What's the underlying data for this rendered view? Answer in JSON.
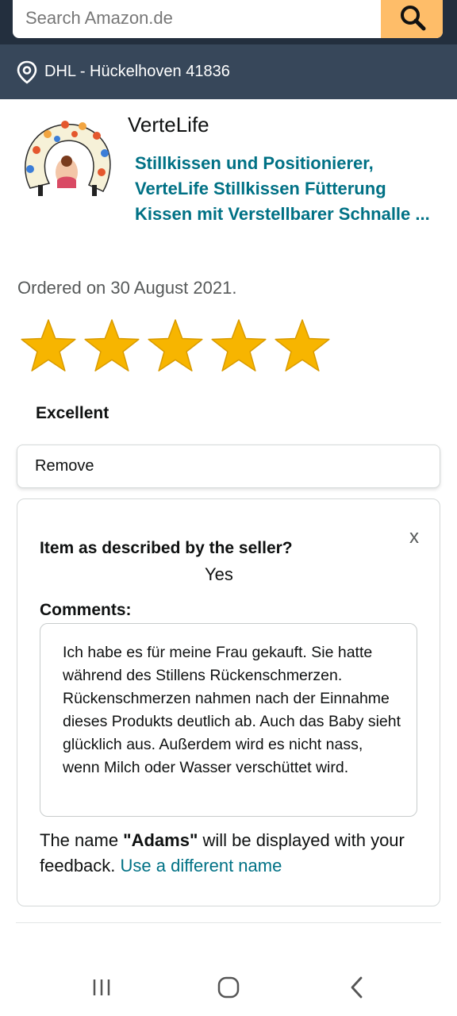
{
  "search": {
    "placeholder": "Search Amazon.de",
    "icon": "search-icon"
  },
  "location": {
    "icon": "location-pin-icon",
    "text": "DHL - Hückelhoven 41836"
  },
  "product": {
    "brand": "VerteLife",
    "title": "Stillkissen und Positionierer, VerteLife Stillkissen Fütterung Kissen mit Verstellbarer Schnalle ...",
    "ordered": "Ordered on 30 August 2021."
  },
  "rating": {
    "stars": 5,
    "max": 5,
    "label": "Excellent",
    "star_color": "#f7b500"
  },
  "remove_label": "Remove",
  "feedback": {
    "close": "x",
    "question": "Item as described by the seller?",
    "answer": "Yes",
    "comments_label": "Comments:",
    "comment": "Ich habe es für meine Frau gekauft. Sie hatte während des Stillens Rückenschmerzen. Rückenschmerzen nahmen nach der Einnahme dieses Produkts deutlich ab. Auch das Baby sieht glücklich aus. Außerdem wird es nicht nass, wenn Milch oder Wasser verschüttet wird.",
    "name_prefix": "The name ",
    "name": "\"Adams\"",
    "name_suffix": " will be displayed with your feedback. ",
    "change_name_link": "Use a different name"
  },
  "colors": {
    "header": "#232f3e",
    "location_bar": "#37475a",
    "search_button": "#febd69",
    "link": "#007185"
  },
  "nav": {
    "recent_icon": "recent-apps-icon",
    "home_icon": "home-icon",
    "back_icon": "back-icon"
  }
}
